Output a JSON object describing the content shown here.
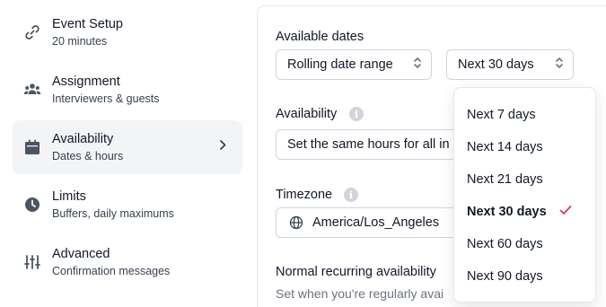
{
  "sidebar": {
    "items": [
      {
        "title": "Event Setup",
        "subtitle": "20 minutes",
        "icon": "link-icon"
      },
      {
        "title": "Assignment",
        "subtitle": "Interviewers & guests",
        "icon": "people-icon"
      },
      {
        "title": "Availability",
        "subtitle": "Dates & hours",
        "icon": "calendar-icon",
        "active": true
      },
      {
        "title": "Limits",
        "subtitle": "Buffers, daily maximums",
        "icon": "clock-icon"
      },
      {
        "title": "Advanced",
        "subtitle": "Confirmation messages",
        "icon": "sliders-icon"
      }
    ]
  },
  "main": {
    "available_dates": {
      "label": "Available dates",
      "range_type": "Rolling date range",
      "range_length": "Next 30 days"
    },
    "availability": {
      "label": "Availability",
      "value": "Set the same hours for all in"
    },
    "timezone": {
      "label": "Timezone",
      "value": "America/Los_Angeles"
    },
    "recurring": {
      "label": "Normal recurring availability",
      "description": "Set when you're regularly avai"
    }
  },
  "dropdown": {
    "options": [
      "Next 7 days",
      "Next 14 days",
      "Next 21 days",
      "Next 30 days",
      "Next 60 days",
      "Next 90 days"
    ],
    "selected": "Next 30 days"
  },
  "colors": {
    "accent_check": "#d9386e",
    "active_bg": "#f3f4f6",
    "border": "#d1d5db"
  }
}
